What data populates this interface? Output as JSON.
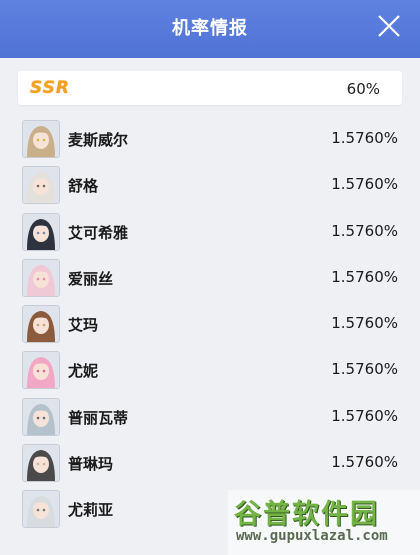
{
  "header": {
    "title": "机率情报"
  },
  "rarity": {
    "label": "SSR",
    "rate": "60%",
    "color": "#f3a21e"
  },
  "characters": [
    {
      "name": "麦斯威尔",
      "rate": "1.5760%",
      "hair": "#c9b08a",
      "accent": "#d8b63a"
    },
    {
      "name": "舒格",
      "rate": "1.5760%",
      "hair": "#e4e0dc",
      "accent": "#6d6a68"
    },
    {
      "name": "艾可希雅",
      "rate": "1.5760%",
      "hair": "#2e3340",
      "accent": "#7c8aa8"
    },
    {
      "name": "爱丽丝",
      "rate": "1.5760%",
      "hair": "#f0c9d6",
      "accent": "#e58aa8"
    },
    {
      "name": "艾玛",
      "rate": "1.5760%",
      "hair": "#8a5b3c",
      "accent": "#c9a27a"
    },
    {
      "name": "尤妮",
      "rate": "1.5760%",
      "hair": "#f2a8c4",
      "accent": "#d8669a"
    },
    {
      "name": "普丽瓦蒂",
      "rate": "1.5760%",
      "hair": "#b4c2cc",
      "accent": "#5a6a78"
    },
    {
      "name": "普琳玛",
      "rate": "1.5760%",
      "hair": "#4a4a4a",
      "accent": "#c9b49a"
    },
    {
      "name": "尤莉亚",
      "rate": "",
      "hair": "#d8dcdf",
      "accent": "#707880"
    }
  ],
  "watermark": {
    "main": "谷普软件园",
    "url": "www.gupuxlazal.com"
  }
}
